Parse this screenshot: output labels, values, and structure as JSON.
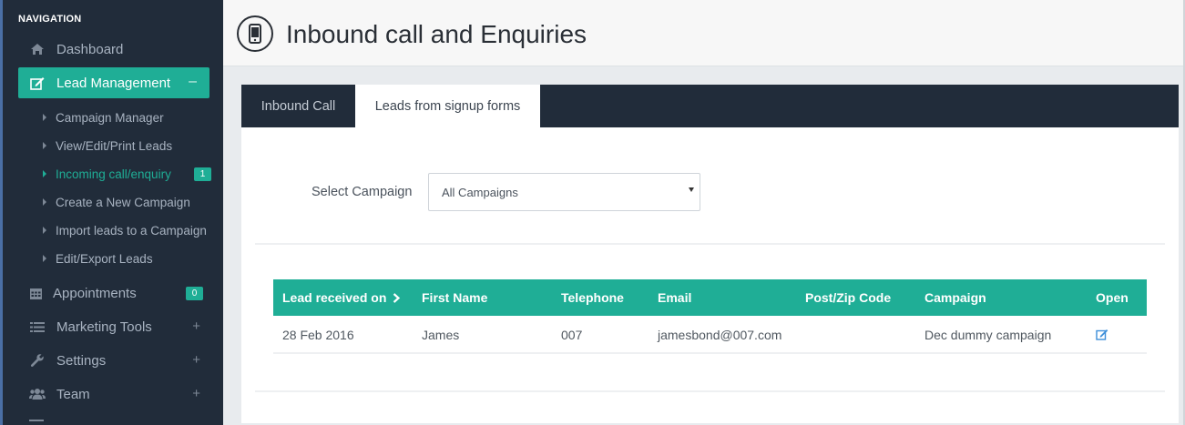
{
  "sidebar": {
    "heading": "NAVIGATION",
    "items": [
      {
        "label": "Dashboard",
        "icon": "home-icon"
      },
      {
        "label": "Lead Management",
        "icon": "edit-icon",
        "toggle": "–"
      },
      {
        "label": "Appointments",
        "icon": "calendar-icon",
        "badge": "0"
      },
      {
        "label": "Marketing Tools",
        "icon": "list-icon",
        "toggle": "+"
      },
      {
        "label": "Settings",
        "icon": "wrench-icon",
        "toggle": "+"
      },
      {
        "label": "Team",
        "icon": "users-icon",
        "toggle": "+"
      }
    ],
    "sub_items": [
      {
        "label": "Campaign Manager"
      },
      {
        "label": "View/Edit/Print Leads"
      },
      {
        "label": "Incoming call/enquiry",
        "badge": "1"
      },
      {
        "label": "Create a New Campaign"
      },
      {
        "label": "Import leads to a Campaign"
      },
      {
        "label": "Edit/Export Leads"
      }
    ]
  },
  "header": {
    "title": "Inbound call and Enquiries",
    "icon": "mobile-phone-icon"
  },
  "tabs": [
    {
      "label": "Inbound Call"
    },
    {
      "label": "Leads from signup forms"
    }
  ],
  "filter": {
    "label": "Select Campaign",
    "selected": "All Campaigns"
  },
  "table": {
    "columns": [
      "Lead received on",
      "First Name",
      "Telephone",
      "Email",
      "Post/Zip Code",
      "Campaign",
      "Open"
    ],
    "rows": [
      {
        "received": "28 Feb 2016",
        "first_name": "James",
        "telephone": "007",
        "email": "jamesbond@007.com",
        "zip": "",
        "campaign": "Dec dummy campaign",
        "open_icon": "edit-icon"
      }
    ]
  },
  "colors": {
    "accent": "#1fae96",
    "sidebar_bg": "#212c3a",
    "link_blue": "#3d8fd9"
  }
}
